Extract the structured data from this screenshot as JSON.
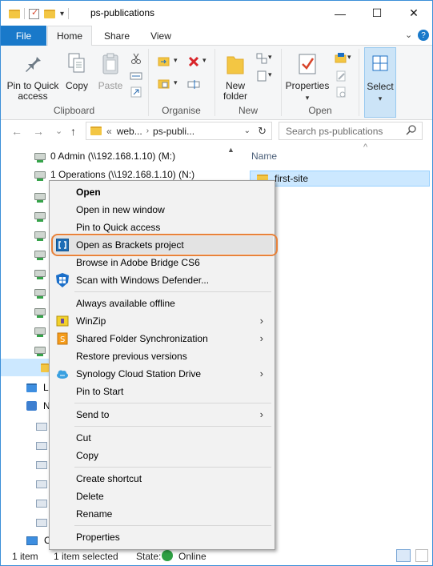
{
  "window": {
    "title": "ps-publications",
    "controls": {
      "minimize": "—",
      "maximize": "☐",
      "close": "✕"
    }
  },
  "ribbon_tabs": {
    "file": "File",
    "home": "Home",
    "share": "Share",
    "view": "View",
    "expand": "⌄",
    "help": "?"
  },
  "ribbon": {
    "clipboard": {
      "label": "Clipboard",
      "pin": "Pin to Quick access",
      "copy": "Copy",
      "paste": "Paste"
    },
    "organise": {
      "label": "Organise"
    },
    "new": {
      "label": "New",
      "new_folder": "New folder"
    },
    "open": {
      "label": "Open",
      "properties": "Properties"
    },
    "select": {
      "label": "Select"
    }
  },
  "address": {
    "back": "←",
    "forward": "→",
    "recent": "⌄",
    "up": "↑",
    "overflow": "«",
    "crumbs": [
      "web...",
      "ps-publi..."
    ],
    "refresh": "↻",
    "search_placeholder": "Search ps-publications"
  },
  "nav_pane": {
    "items": [
      "0 Admin (\\\\192.168.1.10) (M:)",
      "1 Operations (\\\\192.168.1.10) (N:)"
    ],
    "partial_labels": [
      "L",
      "N",
      "C"
    ]
  },
  "main_pane": {
    "column_name": "Name",
    "sort_indicator": "^",
    "files": [
      "first-site"
    ]
  },
  "context_menu": {
    "items": [
      {
        "label": "Open",
        "bold": true
      },
      {
        "label": "Open in new window"
      },
      {
        "label": "Pin to Quick access"
      },
      {
        "label": "Open as Brackets project",
        "icon": "brackets-icon",
        "highlighted": true
      },
      {
        "label": "Browse in Adobe Bridge CS6"
      },
      {
        "label": "Scan with Windows Defender...",
        "icon": "windows-defender-icon"
      },
      {
        "separator": true
      },
      {
        "label": "Always available offline"
      },
      {
        "label": "WinZip",
        "icon": "winzip-icon",
        "submenu": true
      },
      {
        "label": "Shared Folder Synchronization",
        "icon": "sync-folder-icon",
        "submenu": true
      },
      {
        "label": "Restore previous versions"
      },
      {
        "label": "Synology Cloud Station Drive",
        "icon": "cloud-station-icon",
        "submenu": true
      },
      {
        "label": "Pin to Start"
      },
      {
        "separator": true
      },
      {
        "label": "Send to",
        "submenu": true
      },
      {
        "separator": true
      },
      {
        "label": "Cut"
      },
      {
        "label": "Copy"
      },
      {
        "separator": true
      },
      {
        "label": "Create shortcut"
      },
      {
        "label": "Delete"
      },
      {
        "label": "Rename"
      },
      {
        "separator": true
      },
      {
        "label": "Properties"
      }
    ],
    "submenu_arrow": "›"
  },
  "status_bar": {
    "count": "1 item",
    "selected": "1 item selected",
    "state_label": "State:",
    "state_value": "Online"
  },
  "colors": {
    "file_tab": "#1979ca",
    "highlight_ring": "#e8823a",
    "selection": "#cce8ff",
    "online_green": "#2ea043"
  }
}
